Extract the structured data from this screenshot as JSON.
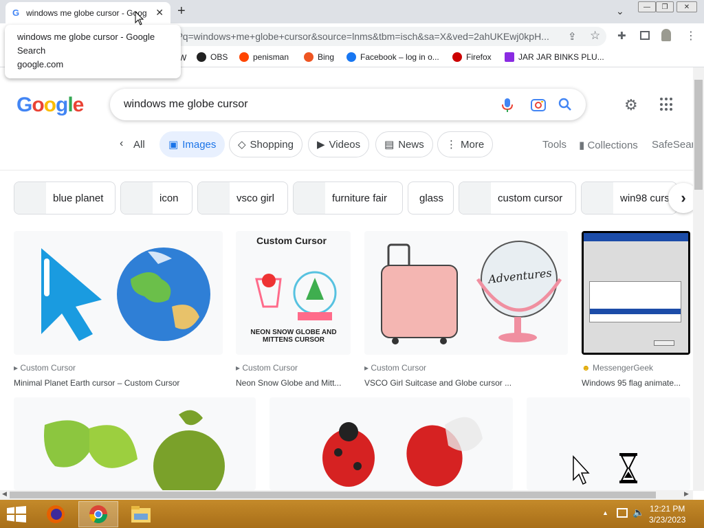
{
  "browser": {
    "tab_title": "windows me globe cursor - Goog",
    "tab_close": "✕",
    "new_tab": "+",
    "address": "?q=windows+me+globe+cursor&source=lnms&tbm=isch&sa=X&ved=2ahUKEwj0kpH...",
    "tooltip_title": "windows me globe cursor - Google Search",
    "tooltip_url": "google.com",
    "bookmarks": [
      "OBS",
      "penisman",
      "Bing",
      "Facebook – log in o...",
      "Firefox",
      "JAR JAR BINKS PLU..."
    ]
  },
  "google": {
    "logo": "Google",
    "query": "windows me globe cursor",
    "filters": [
      "All",
      "Images",
      "Shopping",
      "Videos",
      "News",
      "More"
    ],
    "right_links": [
      "Tools",
      "Collections",
      "SafeSearch"
    ],
    "related": [
      "blue planet",
      "icon",
      "vsco girl",
      "furniture fair",
      "glass",
      "custom cursor",
      "win98 curs"
    ]
  },
  "results": [
    {
      "source": "Custom Cursor",
      "title": "Minimal Planet Earth cursor – Custom Cursor"
    },
    {
      "source": "Custom Cursor",
      "title": "Neon Snow Globe and Mitt..."
    },
    {
      "source": "Custom Cursor",
      "title": "VSCO Girl Suitcase and Globe cursor ..."
    },
    {
      "source": "MessengerGeek",
      "title": "Windows 95 flag animate..."
    }
  ],
  "image_text": {
    "custom_cursor": "Custom Cursor",
    "neon_caption": "Neon Snow Globe and Mittens Cursor",
    "adventures": "Adventures"
  },
  "taskbar": {
    "time": "12:21 PM",
    "date": "3/23/2023"
  },
  "colors": {
    "google_blue": "#4285f4",
    "google_red": "#ea4335",
    "google_yellow": "#fbbc05",
    "google_green": "#34a853",
    "taskbar": "#b67b22",
    "active_chip": "#e8f0fe"
  }
}
